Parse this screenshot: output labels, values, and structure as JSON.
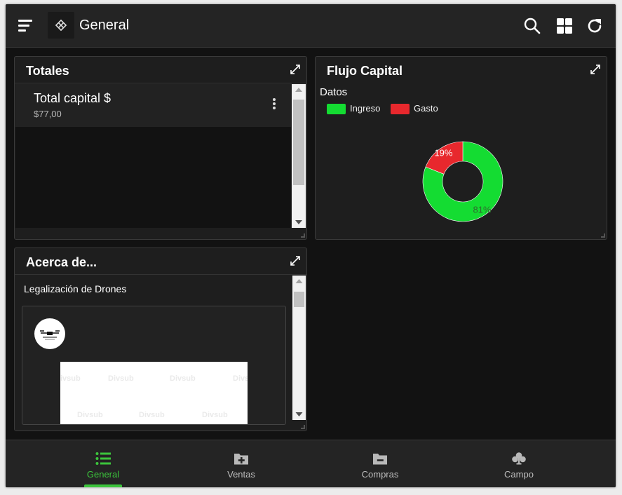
{
  "header": {
    "title": "General"
  },
  "totales": {
    "title": "Totales",
    "items": [
      {
        "label": "Total capital $",
        "value": "$77,00"
      }
    ]
  },
  "flujo": {
    "title": "Flujo Capital",
    "chart_data": {
      "type": "pie",
      "title": "Datos",
      "donut": true,
      "legend_position": "top-left",
      "series": [
        {
          "name": "Ingreso",
          "value": 81,
          "label": "81%",
          "color": "#14dc32"
        },
        {
          "name": "Gasto",
          "value": 19,
          "label": "19%",
          "color": "#e8282d"
        }
      ]
    }
  },
  "acerca": {
    "title": "Acerca de...",
    "subtitle": "Legalización de Drones"
  },
  "nav": {
    "items": [
      {
        "label": "General",
        "icon": "list-icon",
        "active": true
      },
      {
        "label": "Ventas",
        "icon": "folder-plus-icon",
        "active": false
      },
      {
        "label": "Compras",
        "icon": "folder-minus-icon",
        "active": false
      },
      {
        "label": "Campo",
        "icon": "club-icon",
        "active": false
      }
    ]
  },
  "colors": {
    "accent": "#3cc43c",
    "background": "#121212",
    "card": "#1e1e1e",
    "bar": "#242424"
  }
}
